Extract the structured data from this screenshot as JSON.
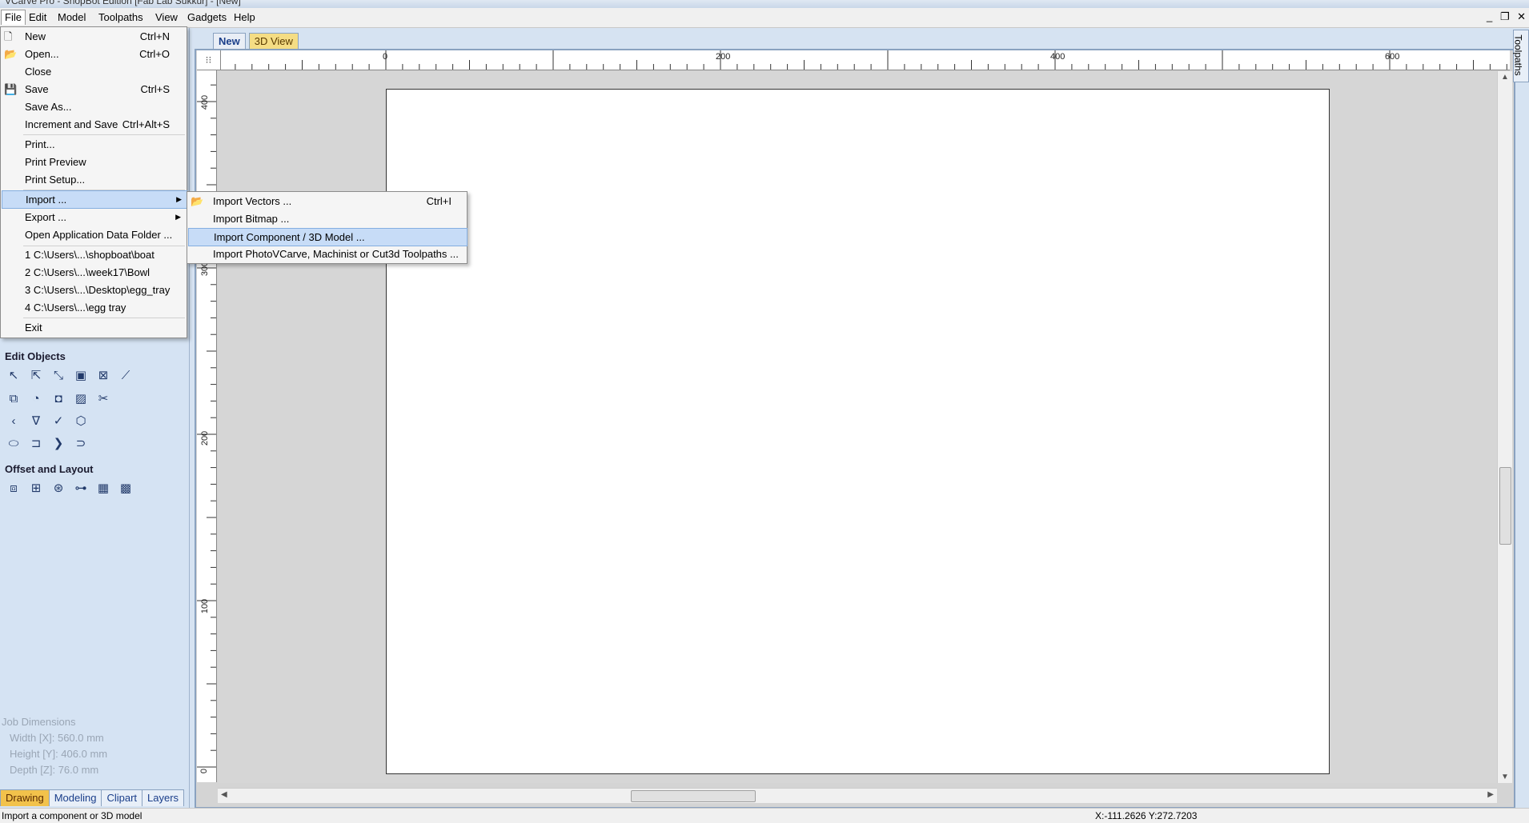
{
  "window": {
    "title": "VCarve Pro - ShopBot Edition [Fab Lab Sukkur] - [New]"
  },
  "menubar": {
    "items": [
      "File",
      "Edit",
      "Model",
      "Toolpaths",
      "View",
      "Gadgets",
      "Help"
    ]
  },
  "window_controls": {
    "minimize": "_",
    "restore": "❐",
    "close": "✕"
  },
  "file_menu": {
    "new": {
      "label": "New",
      "shortcut": "Ctrl+N"
    },
    "open": {
      "label": "Open...",
      "shortcut": "Ctrl+O"
    },
    "close": {
      "label": "Close"
    },
    "save": {
      "label": "Save",
      "shortcut": "Ctrl+S"
    },
    "save_as": {
      "label": "Save As..."
    },
    "increment_save": {
      "label": "Increment and Save",
      "shortcut": "Ctrl+Alt+S"
    },
    "print": {
      "label": "Print..."
    },
    "print_preview": {
      "label": "Print Preview"
    },
    "print_setup": {
      "label": "Print Setup..."
    },
    "import": {
      "label": "Import ..."
    },
    "export": {
      "label": "Export ..."
    },
    "open_app_data": {
      "label": "Open Application Data Folder ..."
    },
    "recent": [
      "1 C:\\Users\\...\\shopboat\\boat",
      "2 C:\\Users\\...\\week17\\Bowl",
      "3 C:\\Users\\...\\Desktop\\egg_tray",
      "4 C:\\Users\\...\\egg tray"
    ],
    "exit": {
      "label": "Exit"
    }
  },
  "import_submenu": {
    "vectors": {
      "label": "Import Vectors ...",
      "shortcut": "Ctrl+I"
    },
    "bitmap": {
      "label": "Import Bitmap ..."
    },
    "component": {
      "label": "Import Component / 3D Model ..."
    },
    "toolpaths": {
      "label": "Import PhotoVCarve, Machinist or Cut3d Toolpaths ..."
    }
  },
  "left_panel": {
    "edit_objects_title": "Edit Objects",
    "offset_layout_title": "Offset and Layout",
    "job_dimensions": {
      "title": "Job Dimensions",
      "width": "Width  [X]: 560.0 mm",
      "height": "Height [Y]: 406.0 mm",
      "depth": "Depth  [Z]: 76.0 mm"
    },
    "tabs": [
      "Drawing",
      "Modeling",
      "Clipart",
      "Layers"
    ]
  },
  "doc_tabs": {
    "new": "New",
    "view3d": "3D View"
  },
  "right_tab": "Toolpaths",
  "ruler": {
    "top_labels": [
      "0",
      "200",
      "400",
      "600"
    ],
    "left_labels": [
      "400",
      "300",
      "200",
      "100",
      "0"
    ]
  },
  "statusbar": {
    "message": "Import a component or 3D model",
    "coords": "X:-111.2626 Y:272.7203"
  },
  "colors": {
    "panel_bg": "#d5e3f3",
    "menu_highlight": "#c7dcf7",
    "active_tab": "#f2c24b"
  }
}
